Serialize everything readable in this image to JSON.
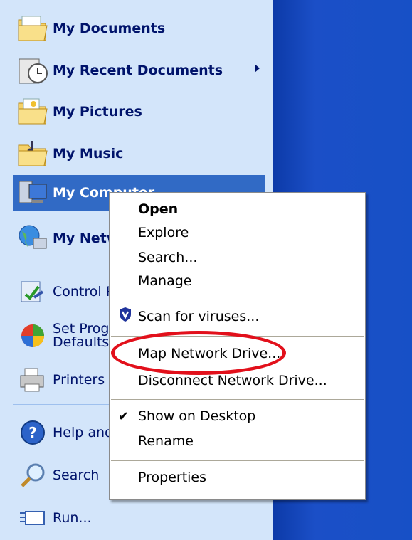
{
  "start_menu": {
    "items": [
      {
        "label": "My Documents",
        "icon": "my-documents-folder-icon"
      },
      {
        "label": "My Recent Documents",
        "icon": "recent-documents-clock-icon"
      },
      {
        "label": "My Pictures",
        "icon": "my-pictures-folder-icon"
      },
      {
        "label": "My Music",
        "icon": "my-music-folder-icon"
      },
      {
        "label": "My Computer",
        "icon": "my-computer-icon"
      },
      {
        "label": "My Network Places",
        "icon": "network-places-globe-icon"
      },
      {
        "label": "Control Panel",
        "icon": "control-panel-icon"
      },
      {
        "label": "Set Program Access and",
        "label2": "Defaults",
        "icon": "program-access-icon"
      },
      {
        "label": "Printers and Faxes",
        "icon": "printer-icon"
      },
      {
        "label": "Help and Support",
        "icon": "help-icon"
      },
      {
        "label": "Search",
        "icon": "search-magnifier-icon"
      },
      {
        "label": "Run...",
        "icon": "run-icon"
      }
    ]
  },
  "context_menu": {
    "open": "Open",
    "explore": "Explore",
    "search": "Search...",
    "manage": "Manage",
    "scan": "Scan for viruses...",
    "map_drive": "Map Network Drive...",
    "disconnect_drive": "Disconnect Network Drive...",
    "show_desktop": "Show on Desktop",
    "rename": "Rename",
    "properties": "Properties"
  },
  "colors": {
    "highlight_oval": "#e2101b",
    "taskbar_blue": "#1750c6",
    "selection": "#316ac5"
  }
}
